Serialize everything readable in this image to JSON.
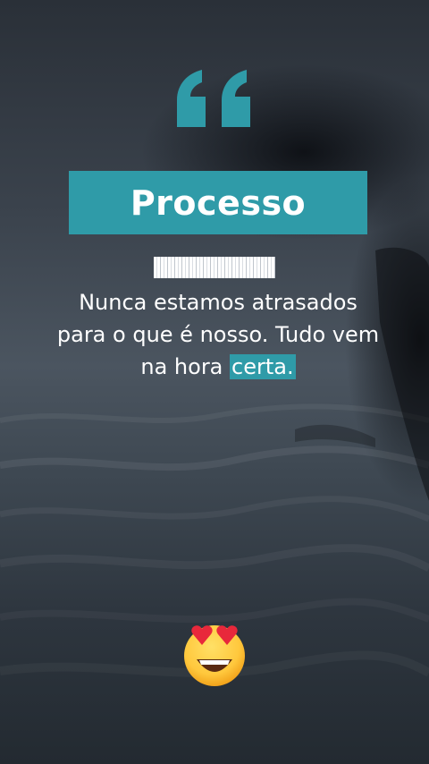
{
  "quote_card": {
    "title": "Processo",
    "text_before": "Nunca estamos atrasados para o que é nosso. Tudo vem na hora ",
    "text_highlight": "certa."
  },
  "colors": {
    "accent": "#2f9ba8",
    "text": "#ffffff"
  },
  "icons": {
    "quote": "quote-mark-icon",
    "emoji": "heart-eyes-emoji-icon"
  }
}
